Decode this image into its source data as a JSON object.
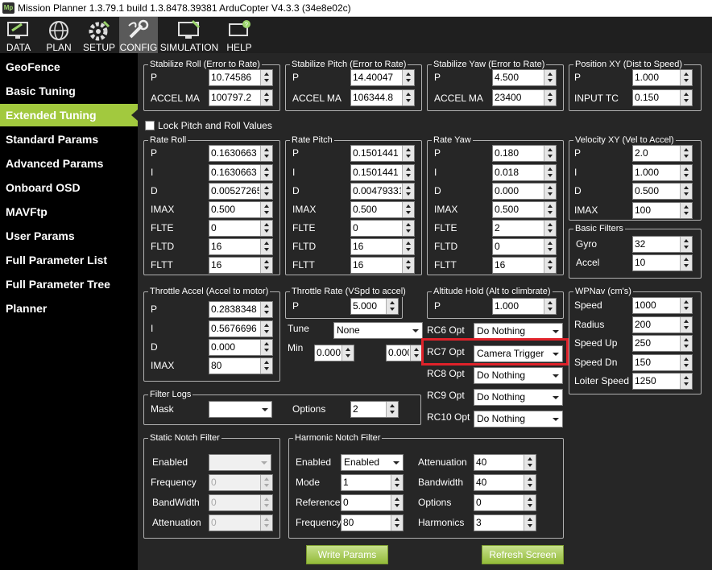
{
  "window": {
    "title": "Mission Planner 1.3.79.1 build 1.3.8478.39381 ArduCopter V4.3.3 (34e8e02c)",
    "icon_text": "Mp"
  },
  "toolbar": [
    {
      "label": "DATA",
      "icon": "data-monitor-icon"
    },
    {
      "label": "PLAN",
      "icon": "globe-icon"
    },
    {
      "label": "SETUP",
      "icon": "gear-icon"
    },
    {
      "label": "CONFIG",
      "icon": "wrench-icon"
    },
    {
      "label": "SIMULATION",
      "icon": "simulation-monitor-icon"
    },
    {
      "label": "HELP",
      "icon": "help-icon"
    }
  ],
  "sidebar": {
    "items": [
      "GeoFence",
      "Basic Tuning",
      "Extended Tuning",
      "Standard Params",
      "Advanced Params",
      "Onboard OSD",
      "MAVFtp",
      "User Params",
      "Full Parameter List",
      "Full Parameter Tree",
      "Planner"
    ],
    "active_index": 2
  },
  "colors": {
    "accent": "#a2c93e",
    "highlight": "#e0222a",
    "background": "#262626"
  },
  "stab_roll": {
    "title": "Stabilize Roll (Error to Rate)",
    "p_label": "P",
    "p": "10.74586",
    "accel_label": "ACCEL MA",
    "accel": "100797.2"
  },
  "stab_pitch": {
    "title": "Stabilize Pitch (Error to Rate)",
    "p_label": "P",
    "p": "14.40047",
    "accel_label": "ACCEL MA",
    "accel": "106344.8"
  },
  "stab_yaw": {
    "title": "Stabilize Yaw (Error to Rate)",
    "p_label": "P",
    "p": "4.500",
    "accel_label": "ACCEL MA",
    "accel": "23400"
  },
  "pos_xy": {
    "title": "Position XY (Dist to Speed)",
    "p_label": "P",
    "p": "1.000",
    "input_label": "INPUT TC",
    "input": "0.150"
  },
  "lock": {
    "label": "Lock Pitch and Roll Values"
  },
  "rate_roll": {
    "title": "Rate Roll",
    "rows": [
      {
        "l": "P",
        "v": "0.1630663"
      },
      {
        "l": "I",
        "v": "0.1630663"
      },
      {
        "l": "D",
        "v": "0.00527265"
      },
      {
        "l": "IMAX",
        "v": "0.500"
      },
      {
        "l": "FLTE",
        "v": "0"
      },
      {
        "l": "FLTD",
        "v": "16"
      },
      {
        "l": "FLTT",
        "v": "16"
      }
    ]
  },
  "rate_pitch": {
    "title": "Rate Pitch",
    "rows": [
      {
        "l": "P",
        "v": "0.1501441"
      },
      {
        "l": "I",
        "v": "0.1501441"
      },
      {
        "l": "D",
        "v": "0.00479331"
      },
      {
        "l": "IMAX",
        "v": "0.500"
      },
      {
        "l": "FLTE",
        "v": "0"
      },
      {
        "l": "FLTD",
        "v": "16"
      },
      {
        "l": "FLTT",
        "v": "16"
      }
    ]
  },
  "rate_yaw": {
    "title": "Rate Yaw",
    "rows": [
      {
        "l": "P",
        "v": "0.180"
      },
      {
        "l": "I",
        "v": "0.018"
      },
      {
        "l": "D",
        "v": "0.000"
      },
      {
        "l": "IMAX",
        "v": "0.500"
      },
      {
        "l": "FLTE",
        "v": "2"
      },
      {
        "l": "FLTD",
        "v": "0"
      },
      {
        "l": "FLTT",
        "v": "16"
      }
    ]
  },
  "vel_xy": {
    "title": "Velocity XY (Vel to Accel)",
    "rows": [
      {
        "l": "P",
        "v": "2.0"
      },
      {
        "l": "I",
        "v": "1.000"
      },
      {
        "l": "D",
        "v": "0.500"
      },
      {
        "l": "IMAX",
        "v": "100"
      }
    ]
  },
  "basic_filters": {
    "title": "Basic Filters",
    "gyro_label": "Gyro",
    "gyro": "32",
    "accel_label": "Accel",
    "accel": "10"
  },
  "thr_accel": {
    "title": "Throttle Accel (Accel to motor)",
    "rows": [
      {
        "l": "P",
        "v": "0.2838348"
      },
      {
        "l": "I",
        "v": "0.5676696"
      },
      {
        "l": "D",
        "v": "0.000"
      },
      {
        "l": "IMAX",
        "v": "80"
      }
    ]
  },
  "thr_rate": {
    "title": "Throttle Rate (VSpd to accel)",
    "p_label": "P",
    "p": "5.000"
  },
  "tune": {
    "label": "Tune",
    "value": "None",
    "min_label": "Min",
    "min": "0.000",
    "max": "0.000"
  },
  "alt_hold": {
    "title": "Altitude Hold (Alt to climbrate)",
    "p_label": "P",
    "p": "1.000"
  },
  "rc_opts": [
    {
      "label": "RC6 Opt",
      "value": "Do Nothing"
    },
    {
      "label": "RC7 Opt",
      "value": "Camera Trigger"
    },
    {
      "label": "RC8 Opt",
      "value": "Do Nothing"
    },
    {
      "label": "RC9 Opt",
      "value": "Do Nothing"
    },
    {
      "label": "RC10 Opt",
      "value": "Do Nothing"
    }
  ],
  "wpnav": {
    "title": "WPNav (cm's)",
    "rows": [
      {
        "l": "Speed",
        "v": "1000"
      },
      {
        "l": "Radius",
        "v": "200"
      },
      {
        "l": "Speed Up",
        "v": "250"
      },
      {
        "l": "Speed Dn",
        "v": "150"
      },
      {
        "l": "Loiter Speed",
        "v": "1250"
      }
    ]
  },
  "filter_logs": {
    "title": "Filter Logs",
    "mask_label": "Mask",
    "mask": "",
    "options_label": "Options",
    "options": "2"
  },
  "static_notch": {
    "title": "Static Notch Filter",
    "enabled_label": "Enabled",
    "enabled": "",
    "freq_label": "Frequency",
    "freq": "0",
    "bw_label": "BandWidth",
    "bw": "0",
    "att_label": "Attenuation",
    "att": "0"
  },
  "harmonic_notch": {
    "title": "Harmonic Notch Filter",
    "enabled_label": "Enabled",
    "enabled": "Enabled",
    "mode_label": "Mode",
    "mode": "1",
    "ref_label": "Reference",
    "ref": "0",
    "freq_label": "Frequency",
    "freq": "80",
    "att_label": "Attenuation",
    "att": "40",
    "bw_label": "Bandwidth",
    "bw": "40",
    "opt_label": "Options",
    "opt": "0",
    "harm_label": "Harmonics",
    "harm": "3"
  },
  "buttons": {
    "write": "Write Params",
    "refresh": "Refresh Screen"
  }
}
